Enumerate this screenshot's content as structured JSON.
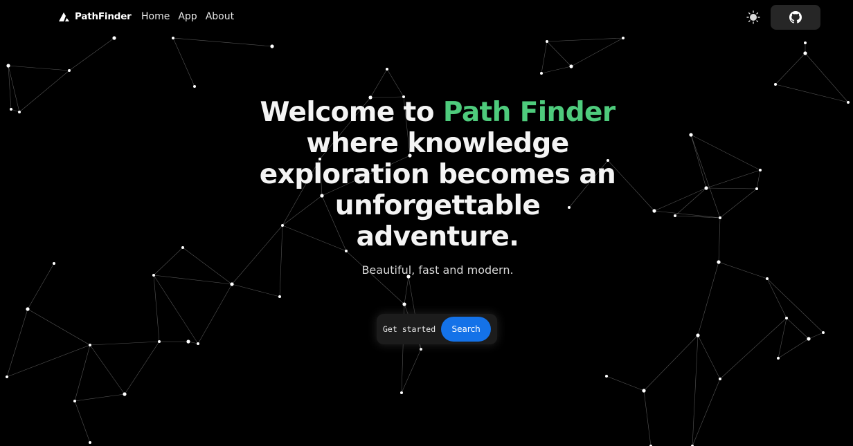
{
  "nav": {
    "brand": "PathFinder",
    "links": [
      {
        "label": "Home"
      },
      {
        "label": "App"
      },
      {
        "label": "About"
      }
    ],
    "theme_icon": "sun-icon",
    "github_icon": "github-icon"
  },
  "hero": {
    "headline_prefix": "Welcome to ",
    "headline_accent": "Path Finder",
    "headline_rest": "where knowledge exploration becomes an unforgettable adventure.",
    "subtitle": "Beautiful, fast and modern."
  },
  "cta": {
    "get_started_label": "Get started",
    "search_label": "Search"
  },
  "colors": {
    "background": "#000000",
    "accent_green": "#4ecb7c",
    "search_blue": "#1472e8",
    "github_button_bg": "#262626"
  }
}
